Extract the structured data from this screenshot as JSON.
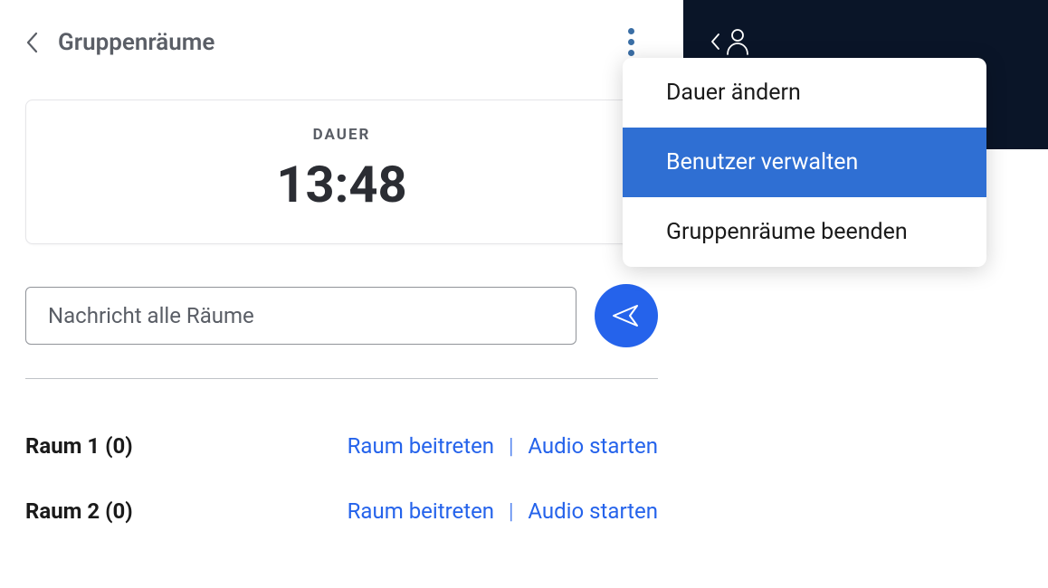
{
  "header": {
    "title": "Gruppenräume"
  },
  "duration": {
    "label": "DAUER",
    "time": "13:48"
  },
  "message": {
    "placeholder": "Nachricht alle Räume"
  },
  "rooms": [
    {
      "name": "Raum 1 (0)",
      "join_label": "Raum beitreten",
      "audio_label": "Audio starten"
    },
    {
      "name": "Raum 2 (0)",
      "join_label": "Raum beitreten",
      "audio_label": "Audio starten"
    }
  ],
  "menu": {
    "items": [
      {
        "label": "Dauer ändern",
        "highlighted": false
      },
      {
        "label": "Benutzer verwalten",
        "highlighted": true
      },
      {
        "label": "Gruppenräume beenden",
        "highlighted": false
      }
    ]
  }
}
